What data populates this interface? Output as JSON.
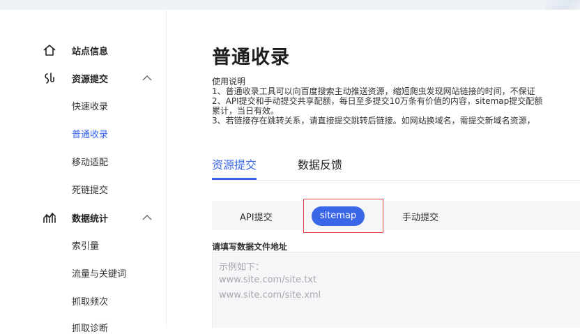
{
  "sidebar": {
    "groups": [
      {
        "label": "站点信息",
        "icon": "home-icon"
      },
      {
        "label": "资源提交",
        "icon": "resource-submit-icon",
        "expanded": true
      },
      {
        "label": "数据统计",
        "icon": "chart-icon",
        "expanded": true
      }
    ],
    "resource_items": [
      "快速收录",
      "普通收录",
      "移动适配",
      "死链提交"
    ],
    "stats_items": [
      "索引量",
      "流量与关键词",
      "抓取频次",
      "抓取诊断"
    ],
    "active_item": "普通收录"
  },
  "main": {
    "title": "普通收录",
    "desc_lines": [
      "使用说明",
      "1、普通收录工具可以向百度搜索主动推送资源，缩短爬虫发现网站链接的时间，不保证",
      "2、API提交和手动提交共享配额，每日至多提交10万条有价值的内容，sitemap提交配额",
      "累计，当日有效。",
      "3、若链接存在跳转关系，请直接提交跳转后链接。如网站换域名，需提交新域名资源，"
    ],
    "tabs": [
      "资源提交",
      "数据反馈"
    ],
    "active_tab": "资源提交",
    "subtabs": [
      "API提交",
      "sitemap",
      "手动提交"
    ],
    "active_subtab": "sitemap",
    "field_label": "请填写数据文件地址",
    "placeholder_lines": [
      "示例如下：",
      "www.site.com/site.txt",
      "www.site.com/site.xml"
    ]
  },
  "colors": {
    "accent": "#3a66e8",
    "highlight": "#e04444",
    "panel": "#f5f6f8"
  }
}
